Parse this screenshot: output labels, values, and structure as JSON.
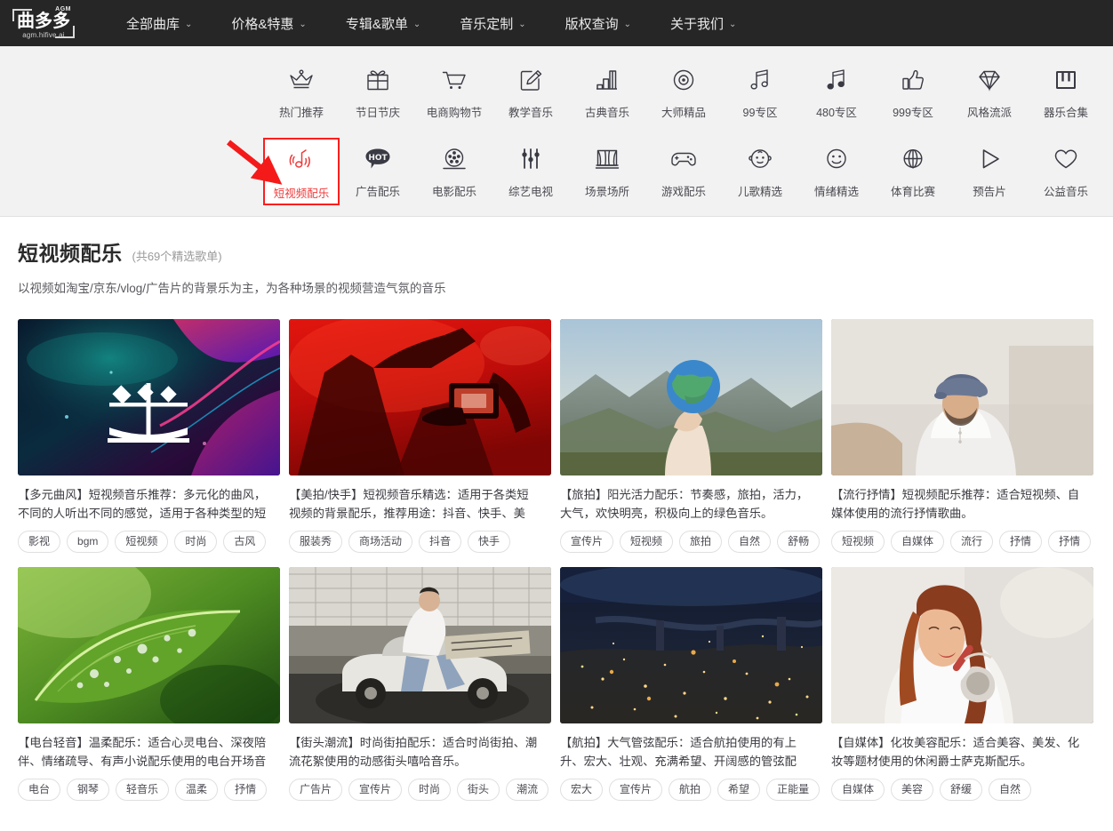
{
  "brand": {
    "logo_main": "曲多多",
    "logo_sup": "AGM",
    "logo_sub": "agm.hifive.ai"
  },
  "nav": {
    "items": [
      {
        "label": "全部曲库",
        "caret": "⌄"
      },
      {
        "label": "价格&特惠",
        "caret": "⌄"
      },
      {
        "label": "专辑&歌单",
        "caret": "⌄"
      },
      {
        "label": "音乐定制",
        "caret": "⌄"
      },
      {
        "label": "版权查询",
        "caret": "⌄"
      },
      {
        "label": "关于我们",
        "caret": "⌄"
      }
    ]
  },
  "categories": {
    "row1": [
      {
        "label": "热门推荐",
        "icon": "crown-icon"
      },
      {
        "label": "节日节庆",
        "icon": "gift-icon"
      },
      {
        "label": "电商购物节",
        "icon": "shopping-cart-icon"
      },
      {
        "label": "教学音乐",
        "icon": "pencil-square-icon"
      },
      {
        "label": "古典音乐",
        "icon": "piano-bars-icon"
      },
      {
        "label": "大师精品",
        "icon": "vinyl-disc-icon"
      },
      {
        "label": "99专区",
        "icon": "music-note-outline-icon"
      },
      {
        "label": "480专区",
        "icon": "music-note-filled-icon"
      },
      {
        "label": "999专区",
        "icon": "thumbs-up-icon"
      },
      {
        "label": "风格流派",
        "icon": "diamond-icon"
      },
      {
        "label": "器乐合集",
        "icon": "keyboard-keys-icon"
      }
    ],
    "row2": [
      {
        "label": "短视频配乐",
        "icon": "short-video-audio-icon",
        "active": true
      },
      {
        "label": "广告配乐",
        "icon": "hot-bubble-icon"
      },
      {
        "label": "电影配乐",
        "icon": "film-reel-icon"
      },
      {
        "label": "综艺电视",
        "icon": "sliders-icon"
      },
      {
        "label": "场景场所",
        "icon": "stage-curtain-icon"
      },
      {
        "label": "游戏配乐",
        "icon": "gamepad-icon"
      },
      {
        "label": "儿歌精选",
        "icon": "baby-face-icon"
      },
      {
        "label": "情绪精选",
        "icon": "smiley-face-icon"
      },
      {
        "label": "体育比赛",
        "icon": "globe-icon"
      },
      {
        "label": "预告片",
        "icon": "play-triangle-icon"
      },
      {
        "label": "公益音乐",
        "icon": "heart-icon"
      }
    ],
    "active_color": "#ef3b3b",
    "highlight_border_color": "#fc1e1e",
    "annotation_arrow_color": "#f51a1a"
  },
  "section": {
    "title": "短视频配乐",
    "count": "(共69个精选歌单)",
    "description": "以视频如淘宝/京东/vlog/广告片的背景乐为主，为各种场景的视频营造气氛的音乐"
  },
  "cards": [
    {
      "thumb": "abstract-neon-mi-character",
      "desc_line1": "【多元曲风】短视频音乐推荐：多元化的曲风，",
      "desc_line2": "不同的人听出不同的感觉，适用于各种类型的短",
      "tags": [
        "影视",
        "bgm",
        "短视频",
        "时尚",
        "古风"
      ]
    },
    {
      "thumb": "red-concert-phone-filming",
      "desc_line1": "【美拍/快手】短视频音乐精选：适用于各类短",
      "desc_line2": "视频的背景配乐，推荐用途：抖音、快手、美",
      "tags": [
        "服装秀",
        "商场活动",
        "抖音",
        "快手"
      ]
    },
    {
      "thumb": "hand-holding-globe-landscape",
      "desc_line1": "【旅拍】阳光活力配乐：节奏感，旅拍，活力，",
      "desc_line2": "大气，欢快明亮，积极向上的绿色音乐。",
      "tags": [
        "宣传片",
        "短视频",
        "旅拍",
        "自然",
        "舒畅"
      ]
    },
    {
      "thumb": "man-with-flat-cap-portrait",
      "desc_line1": "【流行抒情】短视频配乐推荐：适合短视频、自",
      "desc_line2": "媒体使用的流行抒情歌曲。",
      "tags": [
        "短视频",
        "自媒体",
        "流行",
        "抒情",
        "抒情"
      ]
    },
    {
      "thumb": "green-leaf-water-drops",
      "desc_line1": "【电台轻音】温柔配乐：适合心灵电台、深夜陪",
      "desc_line2": "伴、情绪疏导、有声小说配乐使用的电台开场音",
      "tags": [
        "电台",
        "钢琴",
        "轻音乐",
        "温柔",
        "抒情"
      ]
    },
    {
      "thumb": "man-sitting-on-car-street",
      "desc_line1": "【街头潮流】时尚街拍配乐：适合时尚街拍、潮",
      "desc_line2": "流花絮使用的动感街头嘻哈音乐。",
      "tags": [
        "广告片",
        "宣传片",
        "时尚",
        "街头",
        "潮流"
      ]
    },
    {
      "thumb": "city-night-aerial-river",
      "desc_line1": "【航拍】大气管弦配乐：适合航拍使用的有上",
      "desc_line2": "升、宏大、壮观、充满希望、开阔感的管弦配",
      "tags": [
        "宏大",
        "宣传片",
        "航拍",
        "希望",
        "正能量"
      ]
    },
    {
      "thumb": "woman-applying-makeup-mirror",
      "desc_line1": "【自媒体】化妆美容配乐：适合美容、美发、化",
      "desc_line2": "妆等题材使用的休闲爵士萨克斯配乐。",
      "tags": [
        "自媒体",
        "美容",
        "舒缓",
        "自然"
      ]
    }
  ]
}
